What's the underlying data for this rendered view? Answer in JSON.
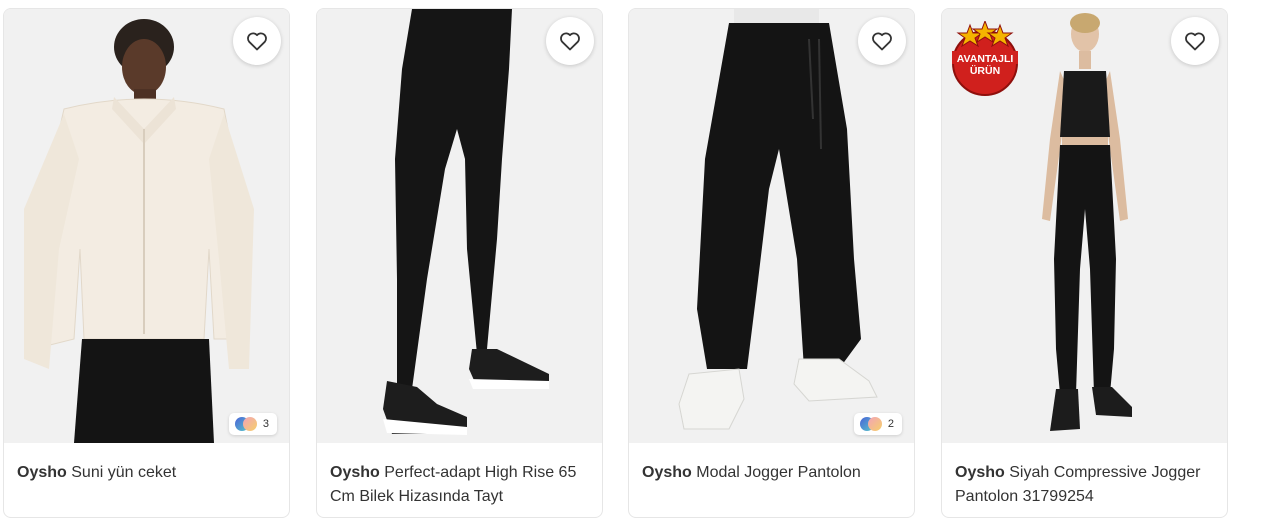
{
  "products": [
    {
      "brand": "Oysho",
      "name": "Suni yün ceket",
      "color_count": "3"
    },
    {
      "brand": "Oysho",
      "name": "Perfect-adapt High Rise 65 Cm Bilek Hizasında Tayt"
    },
    {
      "brand": "Oysho",
      "name": "Modal Jogger Pantolon",
      "color_count": "2"
    },
    {
      "brand": "Oysho",
      "name": "Siyah Compressive Jogger Pantolon 31799254",
      "badge_line1": "AVANTAJLI",
      "badge_line2": "ÜRÜN"
    }
  ],
  "icons": {
    "favorite": "heart-outline-icon",
    "colors": "color-swatch-icon"
  },
  "colors": {
    "badge_red": "#d0201d",
    "badge_star": "#f5b400",
    "image_bg": "#f1f1f1"
  }
}
